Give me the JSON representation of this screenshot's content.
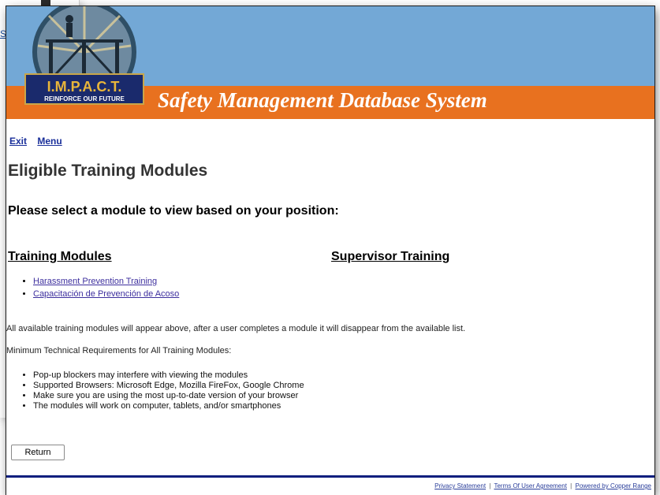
{
  "background": {
    "link_text": "S"
  },
  "header": {
    "logo_text": "I.M.P.A.C.T.",
    "logo_tagline": "REINFORCE OUR FUTURE",
    "system_title": "Safety Management Database System",
    "colors": {
      "banner_blue": "#73a8d6",
      "banner_orange": "#e8711f"
    }
  },
  "nav": {
    "exit_label": "Exit",
    "menu_label": "Menu"
  },
  "page": {
    "title": "Eligible Training Modules",
    "subtitle": "Please select a module to view based on your position:"
  },
  "columns": {
    "training_modules": {
      "heading": "Training Modules",
      "items": [
        "Harassment Prevention Training",
        "Capacitación de Prevención de Acoso"
      ]
    },
    "supervisor_training": {
      "heading": "Supervisor Training"
    }
  },
  "info": {
    "availability_note": "All available training modules will appear above, after a user completes a module it will disappear from the available list.",
    "requirements_heading": "Minimum Technical Requirements for All Training Modules:",
    "requirements": [
      "Pop-up blockers may interfere with viewing the modules",
      "Supported Browsers: Microsoft Edge, Mozilla FireFox, Google Chrome",
      "Make sure you are using the most up-to-date version of your browser",
      "The modules will work on computer, tablets, and/or smartphones"
    ]
  },
  "actions": {
    "return_label": "Return"
  },
  "footer": {
    "privacy": "Privacy Statement",
    "terms": "Terms Of User Agreement",
    "powered": "Powered by Copper Range",
    "separator": "|"
  }
}
